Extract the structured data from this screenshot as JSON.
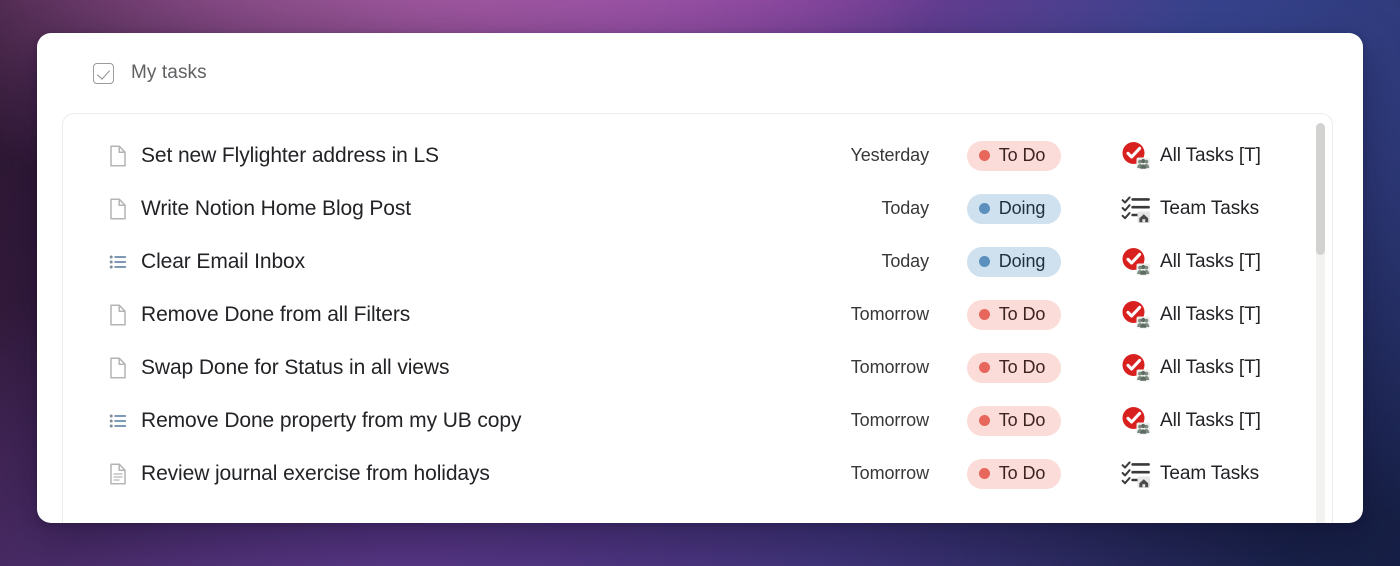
{
  "header": {
    "title": "My tasks",
    "checkbox_icon": "checkbox-checked-icon"
  },
  "colors": {
    "todo_bg": "#fbdcd8",
    "todo_dot": "#e8675c",
    "doing_bg": "#cfe0ee",
    "doing_dot": "#5b90bd",
    "db_all_tasks": "#d8201f",
    "card_bg": "#ffffff",
    "text": "#222326"
  },
  "rows": [
    {
      "icon": "page-icon",
      "title": "Set new Flylighter address in LS",
      "date": "Yesterday",
      "status": "To Do",
      "status_kind": "todo",
      "db_icon": "red-check-people-icon",
      "db_label": "All Tasks [T]"
    },
    {
      "icon": "page-icon",
      "title": "Write Notion Home Blog Post",
      "date": "Today",
      "status": "Doing",
      "status_kind": "doing",
      "db_icon": "checklist-home-icon",
      "db_label": "Team Tasks"
    },
    {
      "icon": "list-icon",
      "title": "Clear Email Inbox",
      "date": "Today",
      "status": "Doing",
      "status_kind": "doing",
      "db_icon": "red-check-people-icon",
      "db_label": "All Tasks [T]"
    },
    {
      "icon": "page-icon",
      "title": "Remove Done from all Filters",
      "date": "Tomorrow",
      "status": "To Do",
      "status_kind": "todo",
      "db_icon": "red-check-people-icon",
      "db_label": "All Tasks [T]"
    },
    {
      "icon": "page-icon",
      "title": "Swap Done for Status in all views",
      "date": "Tomorrow",
      "status": "To Do",
      "status_kind": "todo",
      "db_icon": "red-check-people-icon",
      "db_label": "All Tasks [T]"
    },
    {
      "icon": "list-icon",
      "title": "Remove Done property from my UB copy",
      "date": "Tomorrow",
      "status": "To Do",
      "status_kind": "todo",
      "db_icon": "red-check-people-icon",
      "db_label": "All Tasks [T]"
    },
    {
      "icon": "page-text-icon",
      "title": "Review journal exercise from holidays",
      "date": "Tomorrow",
      "status": "To Do",
      "status_kind": "todo",
      "db_icon": "checklist-home-icon",
      "db_label": "Team Tasks"
    }
  ],
  "scrollbar": {
    "name": "vertical-scrollbar",
    "thumb_position": "top"
  }
}
